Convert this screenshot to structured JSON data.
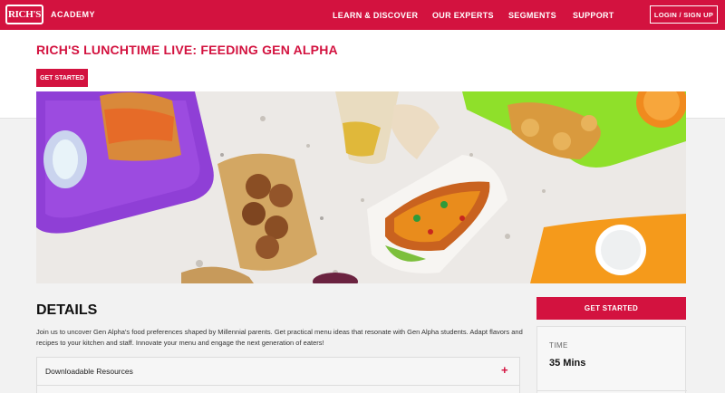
{
  "header": {
    "logo_text": "RICH'S",
    "brand": "ACADEMY",
    "nav": [
      "LEARN & DISCOVER",
      "OUR EXPERTS",
      "SEGMENTS",
      "SUPPORT"
    ],
    "login_label": "LOGIN / SIGN UP",
    "bg_color": "#d3123f"
  },
  "page": {
    "title": "RICH'S LUNCHTIME LIVE: FEEDING GEN ALPHA",
    "cta_label": "GET STARTED"
  },
  "details": {
    "heading": "DETAILS",
    "description": "Join us to uncover Gen Alpha's food preferences shaped by Millennial parents. Get practical menu ideas that resonate with Gen Alpha students. Adapt flavors and recipes to your kitchen and staff. Innovate your menu and engage the next generation of eaters!",
    "accordion_label": "Downloadable Resources",
    "accordion_icon": "+"
  },
  "sidebar": {
    "cta_label": "GET STARTED",
    "time_label": "TIME",
    "time_value": "35 Mins"
  }
}
